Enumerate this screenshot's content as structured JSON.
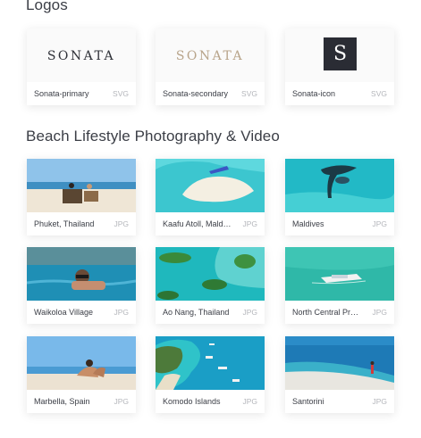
{
  "logos_section": {
    "title": "Logos",
    "items": [
      {
        "label": "Sonata-primary",
        "ext": "SVG",
        "mark": "SONATA",
        "mark_color": "#2f3138"
      },
      {
        "label": "Sonata-secondary",
        "ext": "SVG",
        "mark": "SONATA",
        "mark_color": "#b8a48a"
      },
      {
        "label": "Sonata-icon",
        "ext": "SVG",
        "mark": "S",
        "mark_color": "#2a2c34"
      }
    ]
  },
  "photos_section": {
    "title": "Beach Lifestyle Photography & Video",
    "items": [
      {
        "label": "Phuket, Thailand",
        "ext": "JPG"
      },
      {
        "label": "Kaafu Atoll, Maldives",
        "ext": "JPG"
      },
      {
        "label": "Maldives",
        "ext": "JPG"
      },
      {
        "label": "Waikoloa Village",
        "ext": "JPG"
      },
      {
        "label": "Ao Nang, Thailand",
        "ext": "JPG"
      },
      {
        "label": "North Central Province",
        "ext": "JPG"
      },
      {
        "label": "Marbella, Spain",
        "ext": "JPG"
      },
      {
        "label": "Komodo Islands",
        "ext": "JPG"
      },
      {
        "label": "Santorini",
        "ext": "JPG"
      }
    ]
  }
}
